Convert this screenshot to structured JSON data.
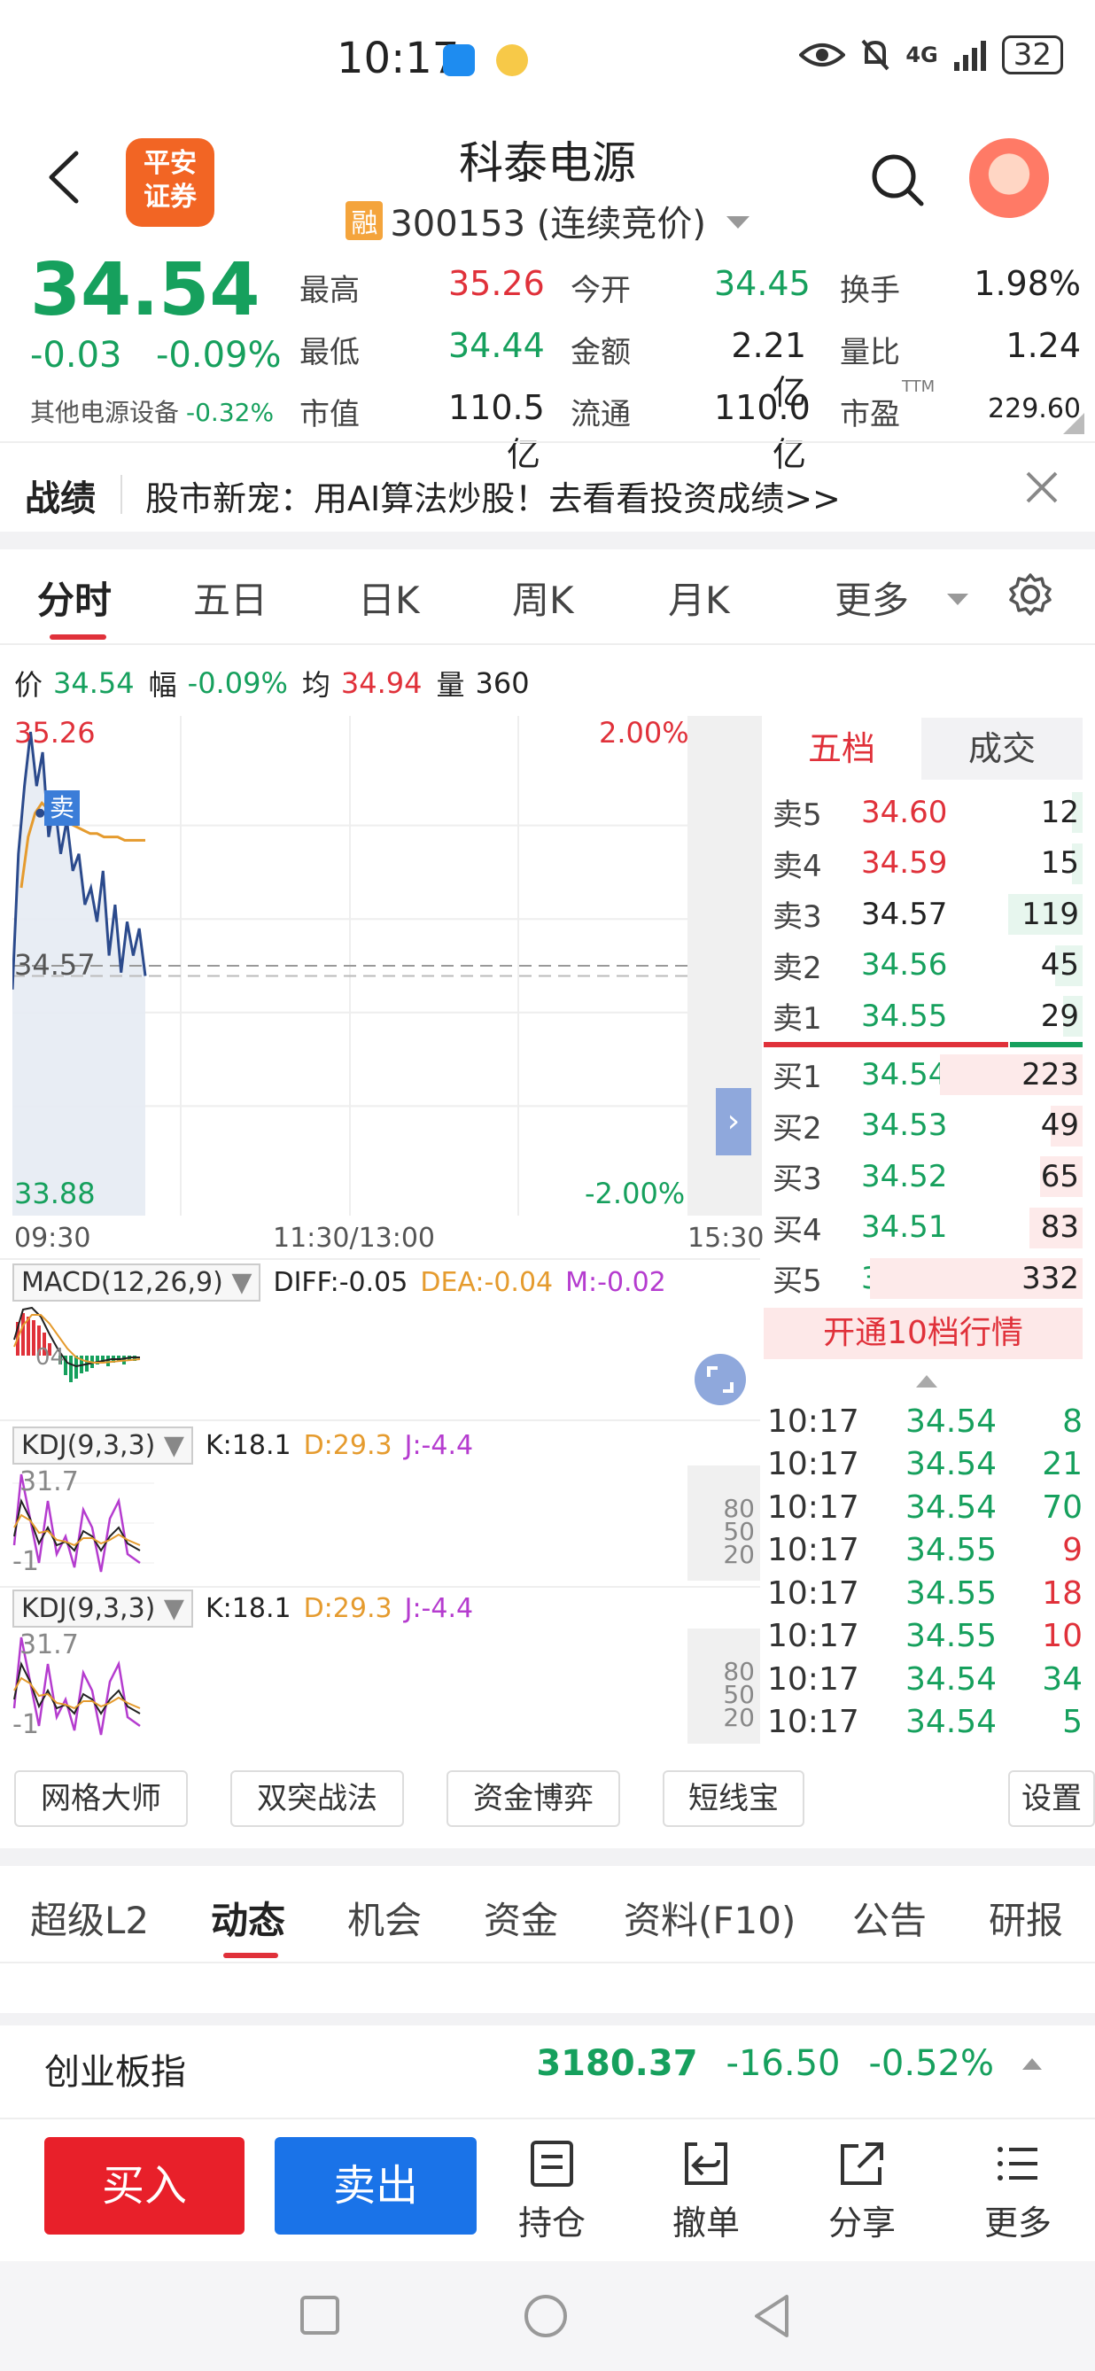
{
  "status_bar": {
    "time": "10:17",
    "network": "4G",
    "battery": "32"
  },
  "header": {
    "stock_name": "科泰电源",
    "margin_badge": "融",
    "stock_code_status": "300153 (连续竞价)",
    "broker_logo_line1": "平安",
    "broker_logo_line2": "证券"
  },
  "quote": {
    "price": "34.54",
    "change": "-0.03",
    "change_pct": "-0.09%",
    "sector_name": "其他电源设备",
    "sector_change": "-0.32%",
    "fields": [
      {
        "label": "最高",
        "value": "35.26",
        "color": "red"
      },
      {
        "label": "今开",
        "value": "34.45",
        "color": "green"
      },
      {
        "label": "换手",
        "value": "1.98%",
        "color": "black"
      },
      {
        "label": "最低",
        "value": "34.44",
        "color": "green"
      },
      {
        "label": "金额",
        "value": "2.21亿",
        "color": "black"
      },
      {
        "label": "量比",
        "value": "1.24",
        "color": "black"
      },
      {
        "label": "市值",
        "value": "110.5亿",
        "color": "black"
      },
      {
        "label": "流通",
        "value": "110.0亿",
        "color": "black"
      },
      {
        "label": "市盈",
        "value": "229.60",
        "color": "black"
      }
    ],
    "pe_superscript": "TTM"
  },
  "banner": {
    "title": "战绩",
    "text": "股市新宠：用AI算法炒股！去看看投资成绩>>"
  },
  "chart_tabs": [
    "分时",
    "五日",
    "日K",
    "周K",
    "月K",
    "更多"
  ],
  "info_line": {
    "price_label": "价",
    "price": "34.54",
    "range_label": "幅",
    "range": "-0.09%",
    "avg_label": "均",
    "avg": "34.94",
    "vol_label": "量",
    "vol": "360"
  },
  "chart_data": {
    "type": "line",
    "title": "",
    "y_ticks_left": [
      "35.26",
      "34.57",
      "33.88"
    ],
    "y_ticks_right": [
      "2.00%",
      "-2.00%"
    ],
    "x_ticks": [
      "09:30",
      "11:30/13:00",
      "15:30"
    ],
    "ylim": [
      33.88,
      35.26
    ],
    "reference_price": 34.57,
    "marker_label": "卖",
    "series": [
      {
        "values": [
          34.5,
          34.9,
          35.1,
          35.26,
          35.1,
          35.2,
          34.95,
          35.05,
          34.9,
          35.0,
          34.85,
          34.9,
          34.75,
          34.8,
          34.7,
          34.85,
          34.6,
          34.75,
          34.55,
          34.7,
          34.6,
          34.68,
          34.54
        ]
      },
      {
        "values": [
          34.8,
          34.95,
          35.02,
          35.05,
          35.03,
          35.02,
          35.0,
          34.99,
          34.98,
          34.97,
          34.96,
          34.96,
          34.95,
          34.95,
          34.95,
          34.94,
          34.94,
          34.94,
          34.94
        ]
      }
    ]
  },
  "macd": {
    "name": "MACD(12,26,9)",
    "diff": "DIFF:-0.05",
    "dea": "DEA:-0.04",
    "m": "M:-0.02",
    "inner_label": "04"
  },
  "kdj1": {
    "name": "KDJ(9,3,3)",
    "k": "K:18.1",
    "d": "D:29.3",
    "j": "J:-4.4",
    "top_label": "31.7",
    "bottom_label": "-1",
    "scale": [
      "80",
      "50",
      "20"
    ]
  },
  "kdj2": {
    "name": "KDJ(9,3,3)",
    "k": "K:18.1",
    "d": "D:29.3",
    "j": "J:-4.4",
    "top_label": "31.7",
    "bottom_label": "-1",
    "scale": [
      "80",
      "50",
      "20"
    ]
  },
  "order_book": {
    "tab_five": "五档",
    "tab_deal": "成交",
    "asks": [
      {
        "label": "卖5",
        "price": "34.60",
        "vol": "12",
        "color": "red",
        "bar": 0.05
      },
      {
        "label": "卖4",
        "price": "34.59",
        "vol": "15",
        "color": "red",
        "bar": 0.05
      },
      {
        "label": "卖3",
        "price": "34.57",
        "vol": "119",
        "color": "black",
        "bar": 0.35
      },
      {
        "label": "卖2",
        "price": "34.56",
        "vol": "45",
        "color": "green",
        "bar": 0.13
      },
      {
        "label": "卖1",
        "price": "34.55",
        "vol": "29",
        "color": "green",
        "bar": 0.09
      }
    ],
    "bids": [
      {
        "label": "买1",
        "price": "34.54",
        "vol": "223",
        "color": "green",
        "bar": 0.67
      },
      {
        "label": "买2",
        "price": "34.53",
        "vol": "49",
        "color": "green",
        "bar": 0.15
      },
      {
        "label": "买3",
        "price": "34.52",
        "vol": "65",
        "color": "green",
        "bar": 0.2
      },
      {
        "label": "买4",
        "price": "34.51",
        "vol": "83",
        "color": "green",
        "bar": 0.25
      },
      {
        "label": "买5",
        "price": "34.50",
        "vol": "332",
        "color": "green",
        "bar": 1.0
      }
    ],
    "cta": "开通10档行情",
    "ticks": [
      {
        "time": "10:17",
        "price": "34.54",
        "vol": "8",
        "color": "green"
      },
      {
        "time": "10:17",
        "price": "34.54",
        "vol": "21",
        "color": "green"
      },
      {
        "time": "10:17",
        "price": "34.54",
        "vol": "70",
        "color": "green"
      },
      {
        "time": "10:17",
        "price": "34.55",
        "vol": "9",
        "color": "red"
      },
      {
        "time": "10:17",
        "price": "34.55",
        "vol": "18",
        "color": "red"
      },
      {
        "time": "10:17",
        "price": "34.55",
        "vol": "10",
        "color": "red"
      },
      {
        "time": "10:17",
        "price": "34.54",
        "vol": "34",
        "color": "green"
      },
      {
        "time": "10:17",
        "price": "34.54",
        "vol": "5",
        "color": "green"
      }
    ]
  },
  "strategies": [
    "网格大师",
    "双突战法",
    "资金博弈",
    "短线宝",
    "设置"
  ],
  "bottom_tabs": [
    "超级L2",
    "动态",
    "机会",
    "资金",
    "资料(F10)",
    "公告",
    "研报"
  ],
  "index_bar": {
    "name": "创业板指",
    "value": "3180.37",
    "change": "-16.50",
    "change_pct": "-0.52%"
  },
  "actions": {
    "buy": "买入",
    "sell": "卖出",
    "items": [
      "持仓",
      "撤单",
      "分享",
      "更多"
    ]
  },
  "colors": {
    "up": "#e0313a",
    "down": "#16a05d",
    "buy": "#e8202a",
    "sell": "#1a73e8",
    "price_line": "#2b4a8c",
    "avg_line": "#e59b2e"
  }
}
